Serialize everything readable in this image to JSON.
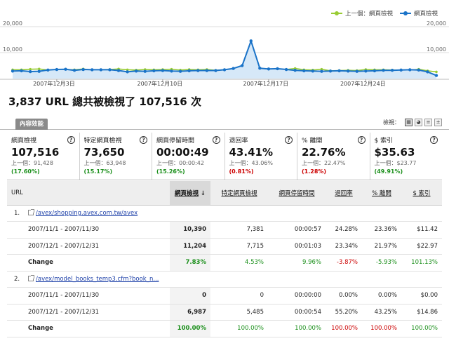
{
  "legend": {
    "prev_label": "上一個：網頁檢視",
    "curr_label": "網頁檢視",
    "prev_color": "#99cc33",
    "curr_color": "#1a73c8"
  },
  "chart_data": {
    "type": "line",
    "y_ticks_left": [
      "20,000",
      "10,000"
    ],
    "y_ticks_right": [
      "20,000",
      "10,000"
    ],
    "ylim": [
      0,
      20000
    ],
    "x_labels": [
      "2007年12月3日",
      "2007年12月10日",
      "2007年12月17日",
      "2007年12月24日"
    ],
    "series": [
      {
        "name": "網頁檢視",
        "color": "#1a73c8",
        "fill": "#d6e8f8",
        "values": [
          2900,
          3000,
          2700,
          2800,
          3300,
          3500,
          3600,
          3200,
          3500,
          3400,
          3400,
          3400,
          3100,
          2600,
          2900,
          2800,
          3000,
          3100,
          2900,
          2800,
          3000,
          3100,
          3100,
          3100,
          3400,
          3900,
          5000,
          14500,
          4000,
          3700,
          3800,
          3500,
          3200,
          3000,
          2900,
          2800,
          2900,
          3000,
          2900,
          2800,
          2900,
          3000,
          3200,
          3200,
          3300,
          3400,
          3300,
          2600,
          1200
        ]
      },
      {
        "name": "上一個：網頁檢視",
        "color": "#99cc33",
        "values": [
          3400,
          3400,
          3600,
          3700,
          3300,
          3300,
          3500,
          3400,
          3700,
          3200,
          3400,
          3500,
          3700,
          3400,
          3300,
          3500,
          3400,
          3500,
          3600,
          3300,
          3500,
          3400,
          3500,
          3200,
          3400,
          3700,
          3600,
          3700,
          3500,
          3400,
          3300,
          3500,
          3900,
          3400,
          3300,
          3600,
          3000,
          3100,
          3200,
          3100,
          3500,
          3400,
          3400,
          3300,
          3300,
          3200,
          3600,
          3000,
          2600
        ]
      }
    ]
  },
  "headline": "3,837 URL 總共被檢視了 107,516 次",
  "tab": {
    "label": "內容效能",
    "view_label": "檢視："
  },
  "cards": [
    {
      "title": "網頁檢視",
      "value": "107,516",
      "prev": "上一個：91,428",
      "change": "(17.60%)",
      "change_color": "green"
    },
    {
      "title": "特定網頁檢視",
      "value": "73,650",
      "prev": "上一個：63,948",
      "change": "(15.17%)",
      "change_color": "green"
    },
    {
      "title": "網頁停留時間",
      "value": "00:00:49",
      "prev": "上一個：00:00:42",
      "change": "(15.26%)",
      "change_color": "green"
    },
    {
      "title": "退回率",
      "value": "43.41%",
      "prev": "上一個：43.06%",
      "change": "(0.81%)",
      "change_color": "red"
    },
    {
      "title": "% 離開",
      "value": "22.76%",
      "prev": "上一個：22.47%",
      "change": "(1.28%)",
      "change_color": "red"
    },
    {
      "title": "$ 索引",
      "value": "$35.63",
      "prev": "上一個：$23.77",
      "change": "(49.91%)",
      "change_color": "green"
    }
  ],
  "help_symbol": "?",
  "table": {
    "headers": [
      "URL",
      "網頁檢視",
      "特定網頁檢視",
      "網頁停留時間",
      "退回率",
      "% 離開",
      "$ 索引"
    ],
    "sort_arrow": "↓",
    "groups": [
      {
        "index": "1.",
        "url": "/avex/shopping.avex.com.tw/avex",
        "rows": [
          {
            "label": "2007/11/1 - 2007/11/30",
            "values": [
              "10,390",
              "7,381",
              "00:00:57",
              "24.28%",
              "23.36%",
              "$11.42"
            ]
          },
          {
            "label": "2007/12/1 - 2007/12/31",
            "values": [
              "11,204",
              "7,715",
              "00:01:03",
              "23.34%",
              "21.97%",
              "$22.97"
            ]
          }
        ],
        "change": {
          "label": "Change",
          "values": [
            "7.83%",
            "4.53%",
            "9.96%",
            "-3.87%",
            "-5.93%",
            "101.13%"
          ],
          "colors": [
            "green",
            "green",
            "green",
            "red",
            "green",
            "green"
          ]
        }
      },
      {
        "index": "2.",
        "url": "/avex/model_books_temp3.cfm?book_n...",
        "rows": [
          {
            "label": "2007/11/1 - 2007/11/30",
            "values": [
              "0",
              "0",
              "00:00:00",
              "0.00%",
              "0.00%",
              "$0.00"
            ]
          },
          {
            "label": "2007/12/1 - 2007/12/31",
            "values": [
              "6,987",
              "5,485",
              "00:00:54",
              "55.20%",
              "43.25%",
              "$14.86"
            ]
          }
        ],
        "change": {
          "label": "Change",
          "values": [
            "100.00%",
            "100.00%",
            "100.00%",
            "100.00%",
            "100.00%",
            "100.00%"
          ],
          "colors": [
            "green",
            "green",
            "green",
            "red",
            "red",
            "green"
          ]
        }
      }
    ]
  }
}
